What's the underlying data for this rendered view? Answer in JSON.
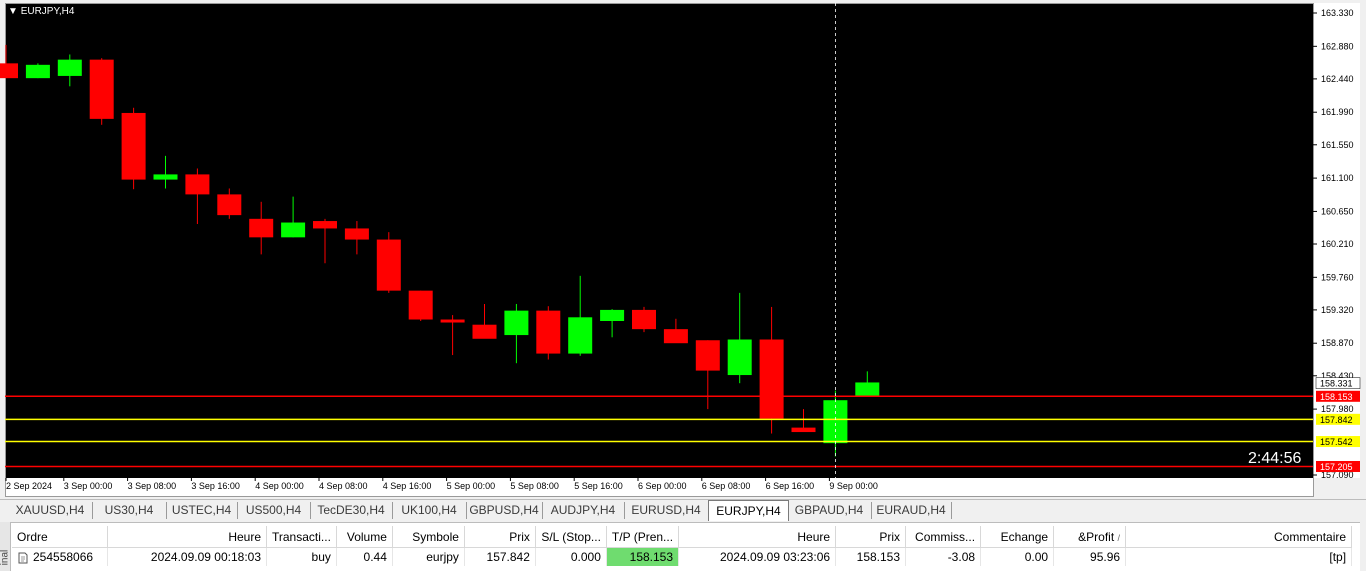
{
  "chart": {
    "title": "EURJPY,H4",
    "countdown": "2:44:56",
    "colors": {
      "background": "#000000",
      "bull": "#00ff00",
      "bear": "#ff0000",
      "tp_line": "#ff0000",
      "entry_line": "#ffff00",
      "crosshair": "#ffffff"
    },
    "price_labels": [
      "163.330",
      "162.880",
      "162.440",
      "161.990",
      "161.550",
      "161.100",
      "160.650",
      "160.210",
      "159.760",
      "159.320",
      "158.870",
      "158.430",
      "157.980",
      "157.090"
    ],
    "time_labels": [
      "2 Sep 2024",
      "3 Sep 00:00",
      "3 Sep 08:00",
      "3 Sep 16:00",
      "4 Sep 00:00",
      "4 Sep 08:00",
      "4 Sep 16:00",
      "5 Sep 00:00",
      "5 Sep 08:00",
      "5 Sep 16:00",
      "6 Sep 00:00",
      "6 Sep 08:00",
      "6 Sep 16:00",
      "9 Sep 00:00"
    ],
    "marker_labels": [
      {
        "text": "158.331",
        "color": "#ffffff",
        "textColor": "#000000"
      },
      {
        "text": "158.153",
        "color": "#ff0000",
        "textColor": "#ffffff"
      },
      {
        "text": "157.842",
        "color": "#ffff00",
        "textColor": "#000000"
      },
      {
        "text": "157.542",
        "color": "#ffff00",
        "textColor": "#000000"
      },
      {
        "text": "157.205",
        "color": "#ff0000",
        "textColor": "#ffffff"
      }
    ]
  },
  "chart_data": {
    "type": "candlestick",
    "title": "EURJPY,H4",
    "ylim": [
      157.09,
      163.33
    ],
    "x": [
      "2 Sep 2024",
      "",
      "3 Sep 00:00",
      "",
      "3 Sep 08:00",
      "",
      "3 Sep 16:00",
      "",
      "4 Sep 00:00",
      "",
      "4 Sep 08:00",
      "",
      "4 Sep 16:00",
      "",
      "5 Sep 00:00",
      "",
      "5 Sep 08:00",
      "",
      "5 Sep 16:00",
      "",
      "6 Sep 00:00",
      "",
      "6 Sep 08:00",
      "",
      "6 Sep 16:00",
      "",
      "9 Sep 00:00",
      ""
    ],
    "candles": [
      {
        "o": 162.65,
        "h": 162.9,
        "l": 162.45,
        "c": 162.45
      },
      {
        "o": 162.45,
        "h": 162.65,
        "l": 162.45,
        "c": 162.63
      },
      {
        "o": 162.48,
        "h": 162.77,
        "l": 162.34,
        "c": 162.7
      },
      {
        "o": 162.7,
        "h": 162.72,
        "l": 161.82,
        "c": 161.9
      },
      {
        "o": 161.98,
        "h": 162.05,
        "l": 160.95,
        "c": 161.08
      },
      {
        "o": 161.08,
        "h": 161.4,
        "l": 160.96,
        "c": 161.15
      },
      {
        "o": 161.15,
        "h": 161.23,
        "l": 160.48,
        "c": 160.88
      },
      {
        "o": 160.88,
        "h": 160.96,
        "l": 160.55,
        "c": 160.6
      },
      {
        "o": 160.55,
        "h": 160.78,
        "l": 160.07,
        "c": 160.3
      },
      {
        "o": 160.3,
        "h": 160.85,
        "l": 160.3,
        "c": 160.5
      },
      {
        "o": 160.52,
        "h": 160.55,
        "l": 159.95,
        "c": 160.42
      },
      {
        "o": 160.42,
        "h": 160.52,
        "l": 160.07,
        "c": 160.27
      },
      {
        "o": 160.27,
        "h": 160.37,
        "l": 159.55,
        "c": 159.58
      },
      {
        "o": 159.58,
        "h": 159.58,
        "l": 159.17,
        "c": 159.19
      },
      {
        "o": 159.19,
        "h": 159.25,
        "l": 158.71,
        "c": 159.16
      },
      {
        "o": 159.12,
        "h": 159.4,
        "l": 158.95,
        "c": 158.93
      },
      {
        "o": 158.98,
        "h": 159.4,
        "l": 158.6,
        "c": 159.31
      },
      {
        "o": 159.31,
        "h": 159.37,
        "l": 158.65,
        "c": 158.73
      },
      {
        "o": 158.73,
        "h": 159.78,
        "l": 158.7,
        "c": 159.22
      },
      {
        "o": 159.17,
        "h": 159.33,
        "l": 158.95,
        "c": 159.32
      },
      {
        "o": 159.32,
        "h": 159.36,
        "l": 159.02,
        "c": 159.06
      },
      {
        "o": 159.06,
        "h": 159.2,
        "l": 158.88,
        "c": 158.87
      },
      {
        "o": 158.91,
        "h": 158.91,
        "l": 157.98,
        "c": 158.5
      },
      {
        "o": 158.44,
        "h": 159.55,
        "l": 158.33,
        "c": 158.92
      },
      {
        "o": 158.92,
        "h": 159.36,
        "l": 157.65,
        "c": 157.85
      },
      {
        "o": 157.73,
        "h": 157.98,
        "l": 157.68,
        "c": 157.67
      },
      {
        "o": 157.52,
        "h": 158.23,
        "l": 157.34,
        "c": 158.1
      },
      {
        "o": 158.16,
        "h": 158.49,
        "l": 158.16,
        "c": 158.34
      }
    ],
    "levels": {
      "tp": 158.153,
      "entry": 157.842,
      "other": 157.542,
      "sl": 157.205,
      "bid": 158.331
    }
  },
  "tabs": [
    "XAUUSD,H4",
    "US30,H4",
    "USTEC,H4",
    "US500,H4",
    "TecDE30,H4",
    "UK100,H4",
    "GBPUSD,H4",
    "AUDJPY,H4",
    "EURUSD,H4",
    "EURJPY,H4",
    "GBPAUD,H4",
    "EURAUD,H4"
  ],
  "active_tab": "EURJPY,H4",
  "terminal": {
    "side_label": "inal",
    "columns": [
      "Ordre",
      "Heure",
      "Transacti...",
      "Volume",
      "Symbole",
      "Prix",
      "S/L (Stop...",
      "T/P (Pren...",
      "Heure",
      "Prix",
      "Commiss...",
      "Echange",
      "&Profit",
      "Commentaire"
    ],
    "sort_indicator": "/",
    "row": {
      "ordre": "254558066",
      "heure_open": "2024.09.09 00:18:03",
      "type": "buy",
      "volume": "0.44",
      "symbole": "eurjpy",
      "prix_open": "157.842",
      "sl": "0.000",
      "tp": "158.153",
      "heure_close": "2024.09.09 03:23:06",
      "prix_close": "158.153",
      "commission": "-3.08",
      "echange": "0.00",
      "profit": "95.96",
      "commentaire": "[tp]"
    }
  }
}
